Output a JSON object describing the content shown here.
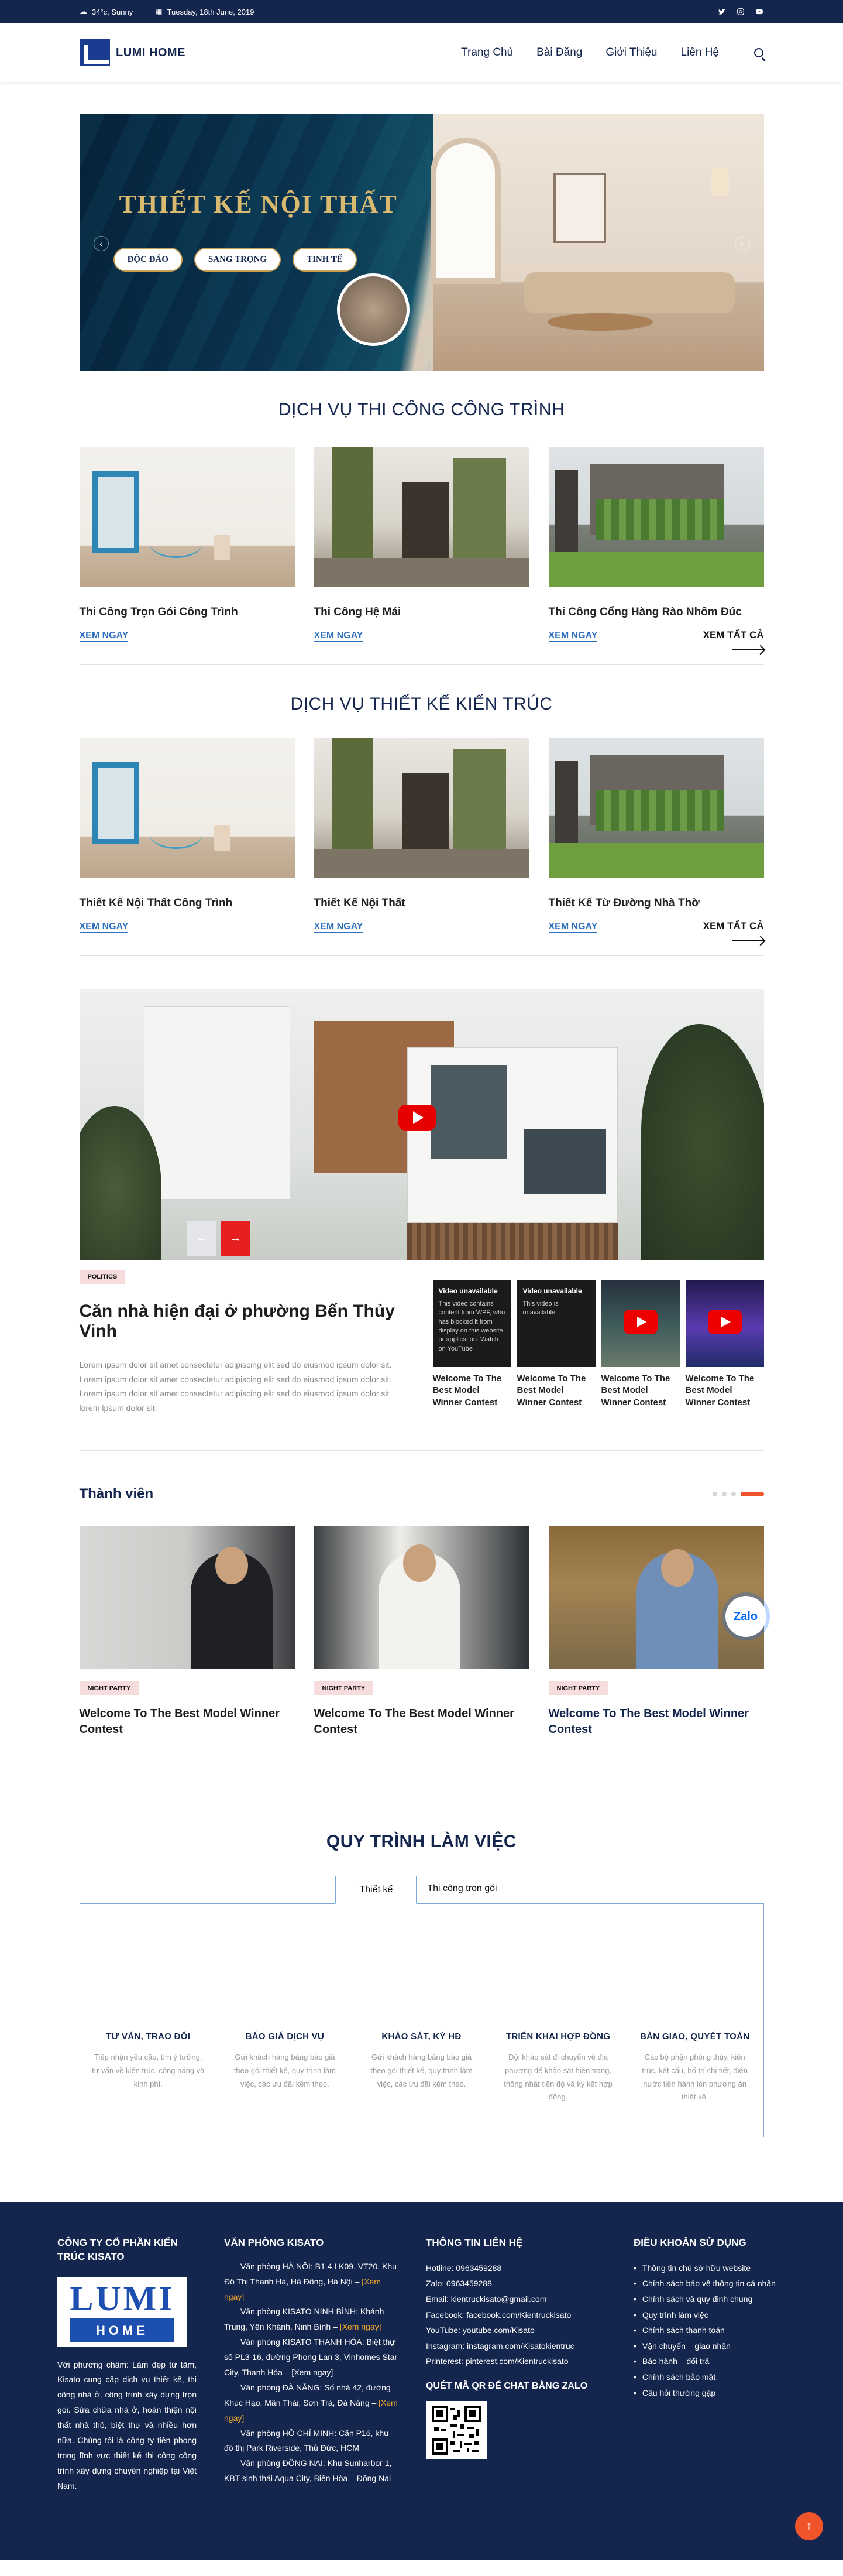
{
  "topbar": {
    "weather": "34°c, Sunny",
    "date": "Tuesday, 18th June, 2019",
    "social_icons": [
      "twitter-icon",
      "instagram-icon",
      "youtube-icon"
    ]
  },
  "header": {
    "logo_text": "LUMI HOME",
    "nav": [
      "Trang Chủ",
      "Bài Đăng",
      "Giới Thiệu",
      "Liên Hệ"
    ]
  },
  "hero": {
    "title": "THIẾT KẾ NỘI THẤT",
    "pills": [
      "ĐỘC ĐÁO",
      "SANG TRỌNG",
      "TINH TẾ"
    ],
    "prev_arrow": "‹",
    "next_arrow": "›"
  },
  "construction": {
    "title": "DỊCH VỤ THI CÔNG CÔNG TRÌNH",
    "cards": [
      {
        "caption": "Thi Công Trọn Gói Công Trình",
        "link": "XEM NGAY"
      },
      {
        "caption": "Thi Công Hệ Mái",
        "link": "XEM NGAY"
      },
      {
        "caption": "Thi Công Cổng Hàng Rào Nhôm Đúc",
        "link": "XEM NGAY"
      }
    ],
    "see_all": "XEM TẤT CẢ"
  },
  "architecture": {
    "title": "DỊCH VỤ THIẾT KẾ KIẾN TRÚC",
    "cards": [
      {
        "caption": "Thiết Kế Nội Thất Công Trình",
        "link": "XEM NGAY"
      },
      {
        "caption": "Thiết Kế Nội Thất",
        "link": "XEM NGAY"
      },
      {
        "caption": "Thiết Kế Từ Đường Nhà  Thờ",
        "link": "XEM NGAY"
      }
    ],
    "see_all": "XEM TẤT CẢ"
  },
  "video": {
    "tag": "POLITICS",
    "title": "Căn nhà hiện đại ở phường Bến Thủy Vinh",
    "description": "Lorem ipsum dolor sit amet consectetur adipiscing elit sed do eiusmod ipsum dolor sit. Lorem ipsum dolor sit amet consectetur adipiscing elit sed do eiusmod ipsum dolor sit. Lorem ipsum dolor sit amet consectetur adipiscing elit sed do eiusmod ipsum dolor sit lorem ipsum dolor sit.",
    "prev": "←",
    "next": "→",
    "thumbs": [
      {
        "heading": "Video unavailable",
        "note": "This video contains content from WPF, who has blocked it from display on this website or application. Watch on YouTube",
        "caption": "Welcome To The Best Model Winner Contest"
      },
      {
        "heading": "Video unavailable",
        "note": "This video is unavailable",
        "caption": "Welcome To The Best Model Winner Contest"
      },
      {
        "heading": "",
        "note": "",
        "caption": "Welcome To The Best Model Winner Contest"
      },
      {
        "heading": "",
        "note": "",
        "caption": "Welcome To The Best Model Winner Contest"
      }
    ]
  },
  "team": {
    "title": "Thành viên",
    "members": [
      {
        "tag": "NIGHT PARTY",
        "name": "Welcome To The Best Model Winner Contest"
      },
      {
        "tag": "NIGHT PARTY",
        "name": "Welcome To The Best Model Winner Contest"
      },
      {
        "tag": "NIGHT PARTY",
        "name": "Welcome To The Best Model Winner Contest"
      }
    ],
    "zalo": "Zalo"
  },
  "process": {
    "title": "QUY TRÌNH LÀM VIỆC",
    "tabs": [
      "Thiết kế",
      "Thi công trọn gói"
    ],
    "steps": [
      {
        "heading": "TƯ VẤN, TRAO ĐỔI",
        "text": "Tiếp nhận yêu cầu, tìm ý tưởng, tư vấn về kiến trúc, công năng và kinh phí."
      },
      {
        "heading": "BÁO GIÁ DỊCH VỤ",
        "text": "Gửi khách hàng bảng báo giá theo gói thiết kế, quy trình làm việc, các ưu đãi kèm theo."
      },
      {
        "heading": "KHẢO SÁT, KÝ HĐ",
        "text": "Gửi khách hàng bảng báo giá theo gói thiết kế, quy trình làm việc, các ưu đãi kèm theo."
      },
      {
        "heading": "TRIỂN KHAI HỢP ĐỒNG",
        "text": "Đội khảo sát đi chuyển về địa phương để khảo sát hiện trạng, thống nhất tiến độ và ký kết hợp đồng."
      },
      {
        "heading": "BÀN GIAO, QUYẾT TOÁN",
        "text": "Các bộ phận phòng thủy, kiến trúc, kết cấu, bổ trí chi tiết, điện nước tiến hành lên phương án thiết kế."
      }
    ]
  },
  "footer": {
    "company": {
      "title": "CÔNG TY CỔ PHẦN KIẾN TRÚC KISATO",
      "logo_top": "LUMI",
      "logo_bottom": "HOME",
      "about": "Với phương châm: Làm đẹp từ tâm, Kisato cung cấp dịch vụ thiết kế, thi công nhà ở, công trình xây dựng trọn gói. Sứa chữa nhà ở, hoàn thiện nội thất nhà thô, biệt thự và nhiều hơn nữa. Chúng tôi là công ty tiên phong trong lĩnh vực thiết kế thi công công trình xây dựng chuyên nghiệp tại Việt Nam."
    },
    "offices": {
      "title": "VĂN PHÒNG KISATO",
      "items": [
        {
          "text": "Văn phòng HÀ NỘI: B1.4.LK09. VT20, Khu Đô Thị Thanh Hà, Hà Đông, Hà Nội –",
          "link": "[Xem ngay]"
        },
        {
          "text": "Văn phòng KISATO NINH BÌNH: Khánh Trung, Yên Khánh, Ninh Bình –",
          "link": "[Xem ngay]"
        },
        {
          "text": "Văn phòng KISATO THANH HÓA: Biệt thự số PL3-16, đường Phong Lan 3, Vinhomes Star City, Thanh Hóa – [Xem ngay]",
          "link": ""
        },
        {
          "text": "Văn phòng ĐÀ NẴNG: Số nhà 42, đường Khúc Hạo, Mân Thái, Sơn Trà, Đà Nẵng –",
          "link": "[Xem ngay]"
        },
        {
          "text": "Văn phòng HỒ CHÍ MINH: Căn P16, khu đô thị Park Riverside, Thủ Đức, HCM",
          "link": ""
        },
        {
          "text": "Văn phòng ĐỒNG NAI: Khu Sunharbor 1, KBT sinh thái Aqua City, Biên Hòa – Đồng Nai",
          "link": ""
        }
      ]
    },
    "contact": {
      "title": "THÔNG TIN LIÊN HỆ",
      "lines": [
        "Hotline: 0963459288",
        "Zalo: 0963459288",
        "Email: kientruckisato@gmail.com",
        "Facebook: facebook.com/Kientruckisato",
        "YouTube: youtube.com/Kisato",
        "Instagram: instagram.com/Kisatokientruc",
        "Printerest: pinterest.com/Kientruckisato"
      ],
      "qr_title": "QUÉT MÃ QR ĐỂ CHAT BẰNG ZALO"
    },
    "terms": {
      "title": "ĐIỀU KHOẢN SỬ DỤNG",
      "items": [
        "Thông tin chủ sở hữu website",
        "Chính sách bảo vệ thông tin cá nhân",
        "Chính sách và quy định chung",
        "Quy trình làm việc",
        "Chính sách thanh toán",
        "Vận chuyển – giao nhận",
        "Bảo hành – đổi trả",
        "Chính sách bảo mật",
        "Câu hỏi thường gặp"
      ]
    },
    "to_top": "↑"
  }
}
